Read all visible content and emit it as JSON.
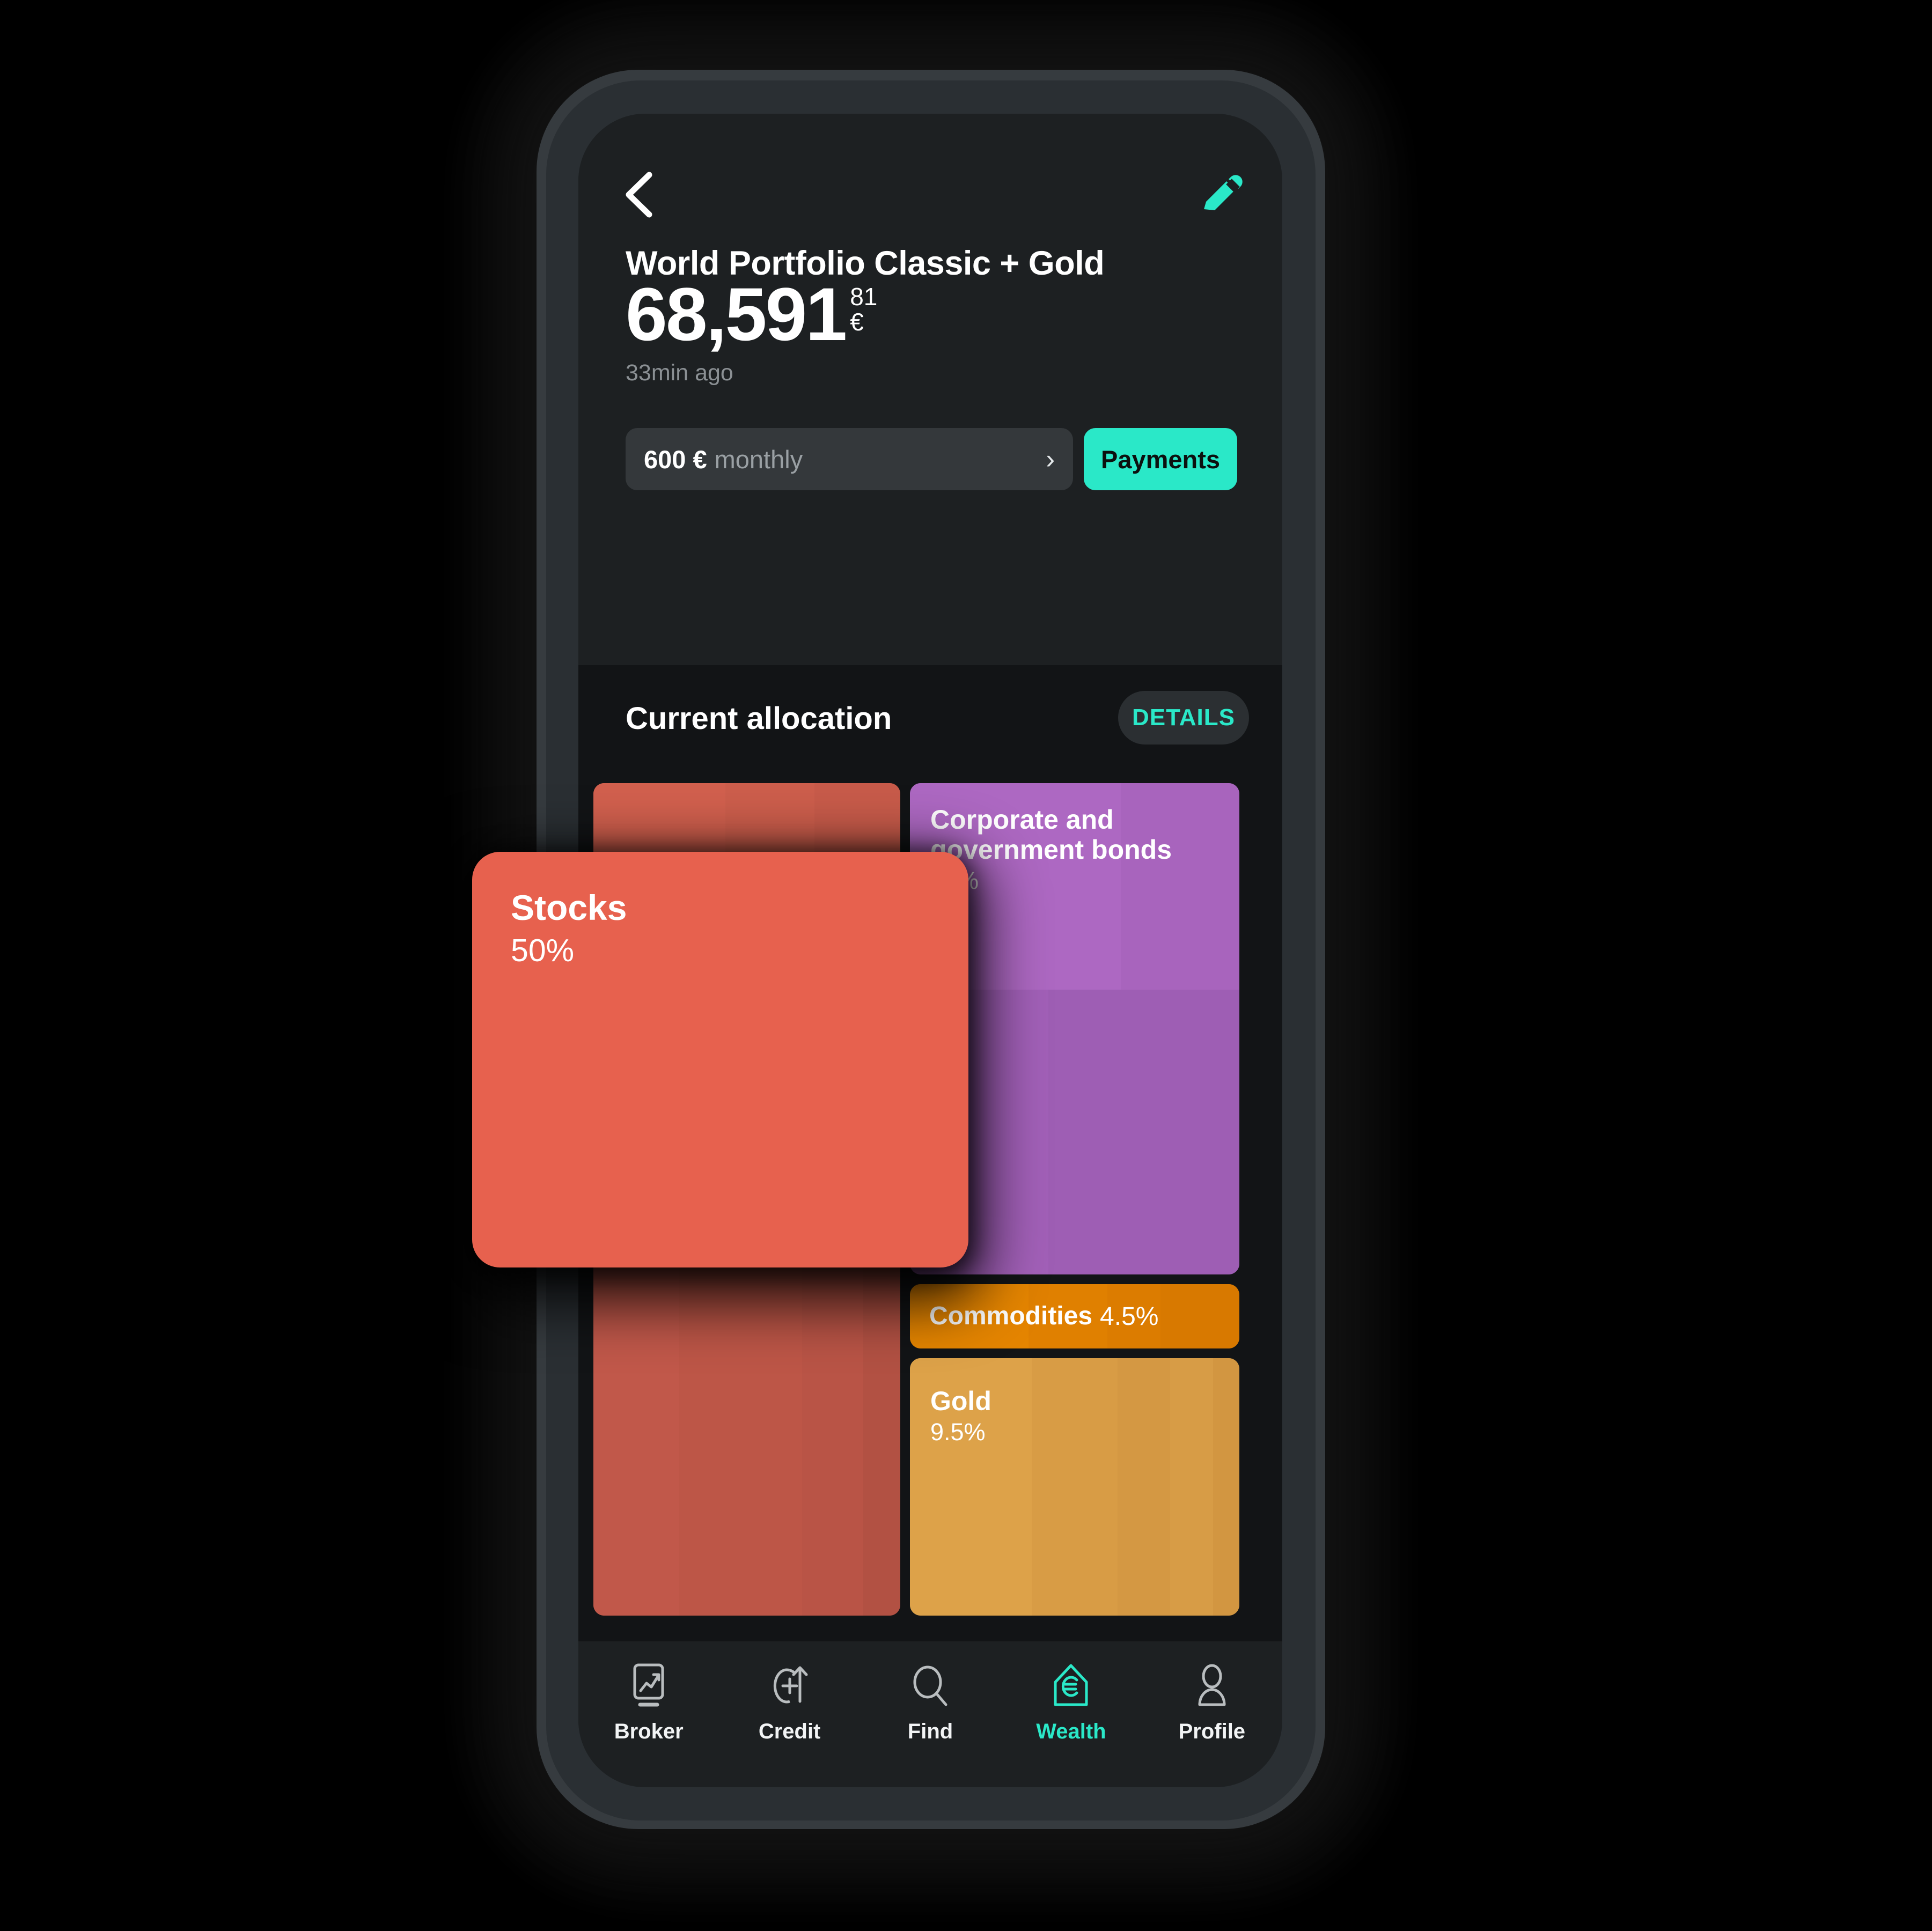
{
  "header": {
    "back_icon": "chevron-left-icon",
    "edit_icon": "pencil-icon",
    "portfolio_title": "World Portfolio Classic + Gold"
  },
  "balance": {
    "amount": "68,591",
    "cents": "81",
    "currency": "€",
    "updated": "33min ago"
  },
  "plan": {
    "amount": "600 €",
    "period": "monthly",
    "chevron": "chevron-right-icon",
    "payments_label": "Payments"
  },
  "allocation": {
    "title": "Current allocation",
    "details_label": "DETAILS"
  },
  "chart_data": {
    "type": "treemap",
    "title": "Current allocation",
    "unit": "%",
    "categories": [
      "Stocks",
      "Corporate and government bonds",
      "Commodities",
      "Gold"
    ],
    "values": [
      50,
      36,
      4.5,
      9.5
    ],
    "series": [
      {
        "name": "Stocks",
        "value": 50,
        "label": "50%",
        "color": "#e7614e"
      },
      {
        "name": "Corporate and government bonds",
        "value": 36,
        "label": "36%",
        "color": "#ab66c0"
      },
      {
        "name": "Commodities",
        "value": 4.5,
        "label": "4.5%",
        "color": "#e38200"
      },
      {
        "name": "Gold",
        "value": 9.5,
        "label": "9.5%",
        "color": "#dba048"
      }
    ],
    "legend": "none",
    "grid": false
  },
  "tiles": {
    "stocks": {
      "name": "Stocks",
      "pct": "50%"
    },
    "bonds": {
      "name": "Corporate and government bonds",
      "pct": "36%"
    },
    "commodities": {
      "name": "Commodities",
      "pct": "4.5%"
    },
    "gold": {
      "name": "Gold",
      "pct": "9.5%"
    }
  },
  "tabs": [
    {
      "label": "Broker",
      "icon": "broker-chart-icon",
      "active": false
    },
    {
      "label": "Credit",
      "icon": "credit-arrow-icon",
      "active": false
    },
    {
      "label": "Find",
      "icon": "search-icon",
      "active": false
    },
    {
      "label": "Wealth",
      "icon": "wealth-euro-shield-icon",
      "active": true
    },
    {
      "label": "Profile",
      "icon": "person-icon",
      "active": false
    }
  ],
  "colors": {
    "accent": "#2AE8C8",
    "stocks": "#E7614E",
    "bonds": "#AB66C0",
    "commodities": "#E38200",
    "gold": "#DBA048",
    "screen_bg": "#121416",
    "hero_bg": "#1D2022"
  }
}
